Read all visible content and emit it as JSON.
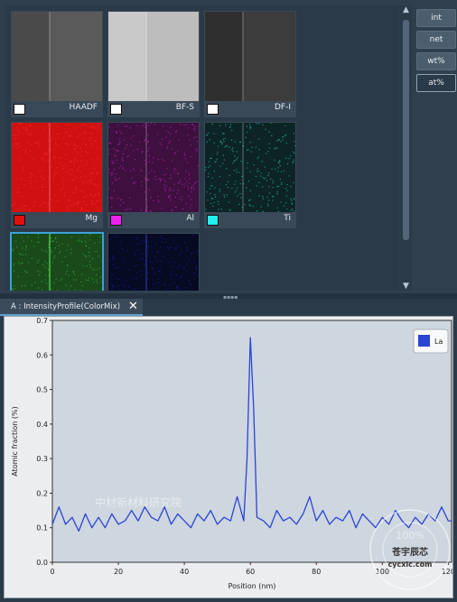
{
  "maps": [
    {
      "label": "HAADF",
      "swatch": "#ffffff",
      "kind": "gray",
      "tone": "#5a5a5a"
    },
    {
      "label": "BF-S",
      "swatch": "#ffffff",
      "kind": "gray",
      "tone": "#bdbdbd"
    },
    {
      "label": "DF-I",
      "swatch": "#ffffff",
      "kind": "gray",
      "tone": "#3c3c3c"
    },
    {
      "label": "Mg",
      "swatch": "#e01010",
      "kind": "color",
      "tone": "#d11010"
    },
    {
      "label": "Al",
      "swatch": "#ee22ee",
      "kind": "color",
      "tone": "#3f0f3f"
    },
    {
      "label": "Ti",
      "swatch": "#22eeee",
      "kind": "color",
      "tone": "#0c2425"
    },
    {
      "label": "",
      "swatch": "",
      "kind": "color",
      "tone": "#1a4a1a"
    },
    {
      "label": "",
      "swatch": "",
      "kind": "color",
      "tone": "#060a22"
    }
  ],
  "side_buttons": [
    "int",
    "net",
    "wt%",
    "at%"
  ],
  "active_button": "at%",
  "tab": {
    "title": "A : IntensityProfile(ColorMix)",
    "close_icon": "close-icon"
  },
  "chart_data": {
    "type": "line",
    "title": "",
    "xlabel": "Position (nm)",
    "ylabel": "Atomic fraction (%)",
    "xlim": [
      0,
      121
    ],
    "ylim": [
      0,
      0.7
    ],
    "xticks": [
      0,
      20,
      40,
      60,
      80,
      100,
      120
    ],
    "yticks": [
      0.0,
      0.1,
      0.2,
      0.3,
      0.4,
      0.5,
      0.6,
      0.7
    ],
    "grid": false,
    "legend_position": "top-right",
    "series": [
      {
        "name": "La",
        "color": "#2a44d4",
        "x": [
          0,
          2,
          4,
          6,
          8,
          10,
          12,
          14,
          16,
          18,
          20,
          22,
          24,
          26,
          28,
          30,
          32,
          34,
          36,
          38,
          40,
          42,
          44,
          46,
          48,
          50,
          52,
          54,
          56,
          58,
          59,
          60,
          61,
          62,
          64,
          66,
          68,
          70,
          72,
          74,
          76,
          78,
          80,
          82,
          84,
          86,
          88,
          90,
          92,
          94,
          96,
          98,
          100,
          102,
          104,
          106,
          108,
          110,
          112,
          114,
          116,
          118,
          120,
          121
        ],
        "y": [
          0.11,
          0.16,
          0.11,
          0.13,
          0.09,
          0.14,
          0.1,
          0.13,
          0.1,
          0.14,
          0.11,
          0.12,
          0.15,
          0.12,
          0.16,
          0.13,
          0.12,
          0.16,
          0.11,
          0.14,
          0.12,
          0.1,
          0.14,
          0.12,
          0.15,
          0.11,
          0.13,
          0.12,
          0.19,
          0.12,
          0.3,
          0.65,
          0.45,
          0.13,
          0.12,
          0.1,
          0.15,
          0.12,
          0.13,
          0.11,
          0.14,
          0.19,
          0.12,
          0.15,
          0.11,
          0.13,
          0.12,
          0.15,
          0.1,
          0.14,
          0.12,
          0.1,
          0.13,
          0.11,
          0.15,
          0.12,
          0.1,
          0.13,
          0.11,
          0.14,
          0.12,
          0.16,
          0.12,
          0.12
        ]
      }
    ]
  },
  "watermarks": [
    "中材新材料研究院",
    "100%",
    "苍宇辰芯",
    "cycxic.com"
  ]
}
